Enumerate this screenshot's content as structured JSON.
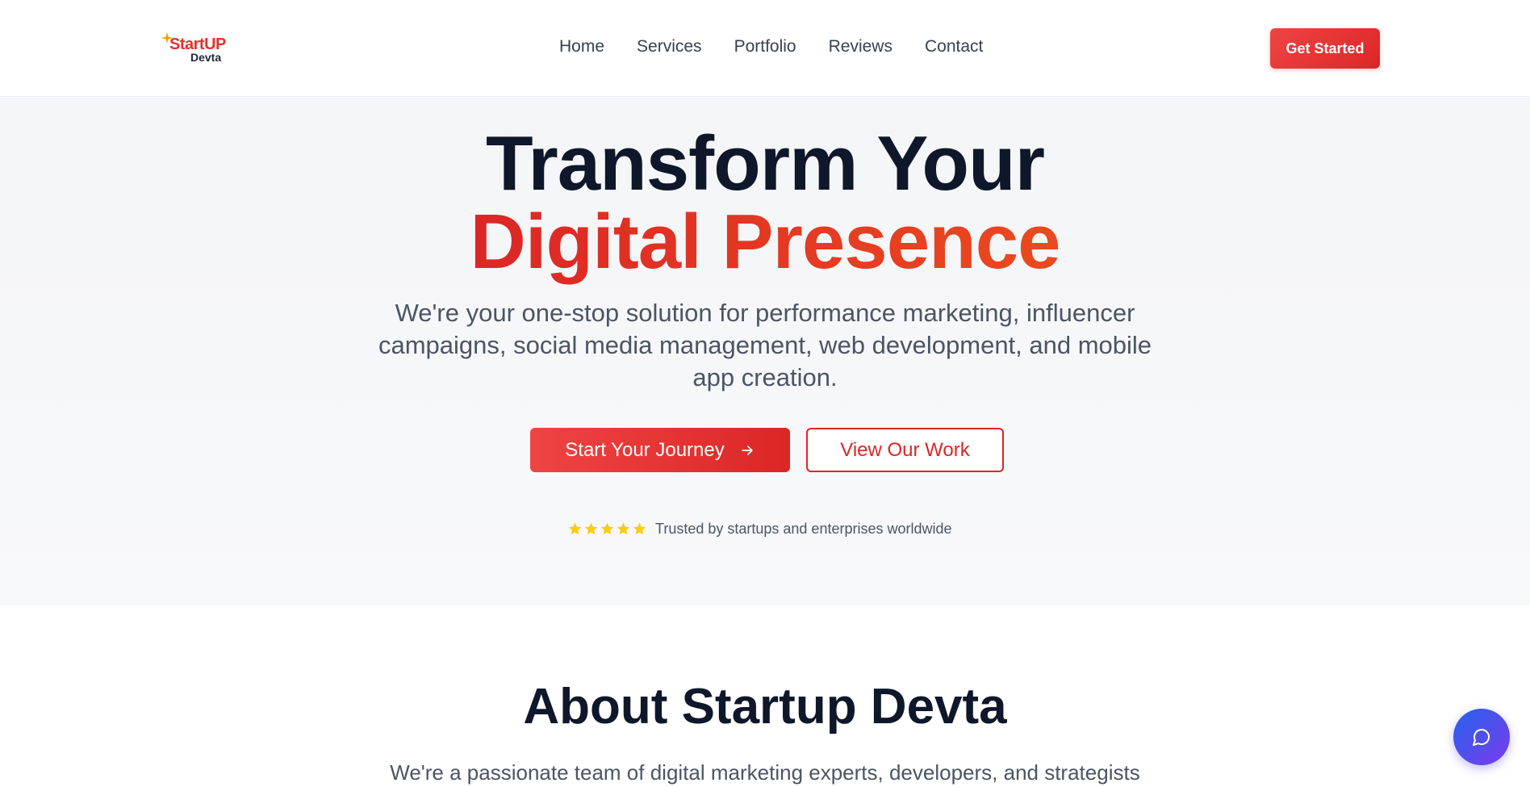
{
  "brand": {
    "name_line1": "StartUP",
    "name_line2": "Devta"
  },
  "nav": {
    "items": [
      "Home",
      "Services",
      "Portfolio",
      "Reviews",
      "Contact"
    ],
    "cta_label": "Get Started"
  },
  "hero": {
    "title_line1": "Transform Your",
    "title_line2": "Digital Presence",
    "subtitle": "We're your one-stop solution for performance marketing, influencer campaigns, social media management, web development, and mobile app creation.",
    "primary_button": "Start Your Journey",
    "secondary_button": "View Our Work",
    "rating_stars": 5,
    "trust_text": "Trusted by startups and enterprises worldwide"
  },
  "about": {
    "title": "About Startup Devta",
    "text": "We're a passionate team of digital marketing experts, developers, and strategists"
  },
  "colors": {
    "accent": "#dc2626",
    "star": "#facc15",
    "chat_gradient_start": "#2563eb",
    "chat_gradient_end": "#7c3aed"
  },
  "icons": {
    "primary_button_icon": "arrow-right-icon",
    "chat_icon": "message-circle-icon"
  }
}
